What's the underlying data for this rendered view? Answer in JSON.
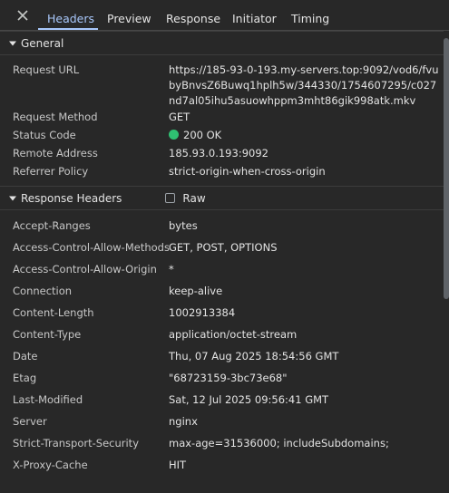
{
  "tabs": {
    "headers": "Headers",
    "preview": "Preview",
    "response": "Response",
    "initiator": "Initiator",
    "timing": "Timing"
  },
  "general": {
    "title": "General",
    "rows": [
      {
        "key": "Request URL",
        "value": "https://185-93-0-193.my-servers.top:9092/vod6/fvubyBnvsZ6Buwq1hplh5w/344330/1754607295/c027nd7al05ihu5asuowhppm3mht86gik998atk.mkv"
      },
      {
        "key": "Request Method",
        "value": "GET"
      },
      {
        "key": "Status Code",
        "value": "200 OK"
      },
      {
        "key": "Remote Address",
        "value": "185.93.0.193:9092"
      },
      {
        "key": "Referrer Policy",
        "value": "strict-origin-when-cross-origin"
      }
    ]
  },
  "response_headers": {
    "title": "Response Headers",
    "raw_label": "Raw",
    "rows": [
      {
        "key": "Accept-Ranges",
        "value": "bytes"
      },
      {
        "key": "Access-Control-Allow-Methods",
        "value": "GET, POST, OPTIONS"
      },
      {
        "key": "Access-Control-Allow-Origin",
        "value": "*"
      },
      {
        "key": "Connection",
        "value": "keep-alive"
      },
      {
        "key": "Content-Length",
        "value": "1002913384"
      },
      {
        "key": "Content-Type",
        "value": "application/octet-stream"
      },
      {
        "key": "Date",
        "value": "Thu, 07 Aug 2025 18:54:56 GMT"
      },
      {
        "key": "Etag",
        "value": "\"68723159-3bc73e68\""
      },
      {
        "key": "Last-Modified",
        "value": "Sat, 12 Jul 2025 09:56:41 GMT"
      },
      {
        "key": "Server",
        "value": "nginx"
      },
      {
        "key": "Strict-Transport-Security",
        "value": "max-age=31536000; includeSubdomains;"
      },
      {
        "key": "X-Proxy-Cache",
        "value": "HIT"
      }
    ]
  },
  "colors": {
    "background": "#282828",
    "active_tab": "#a8c7fa",
    "status_ok": "#2fbf71"
  }
}
